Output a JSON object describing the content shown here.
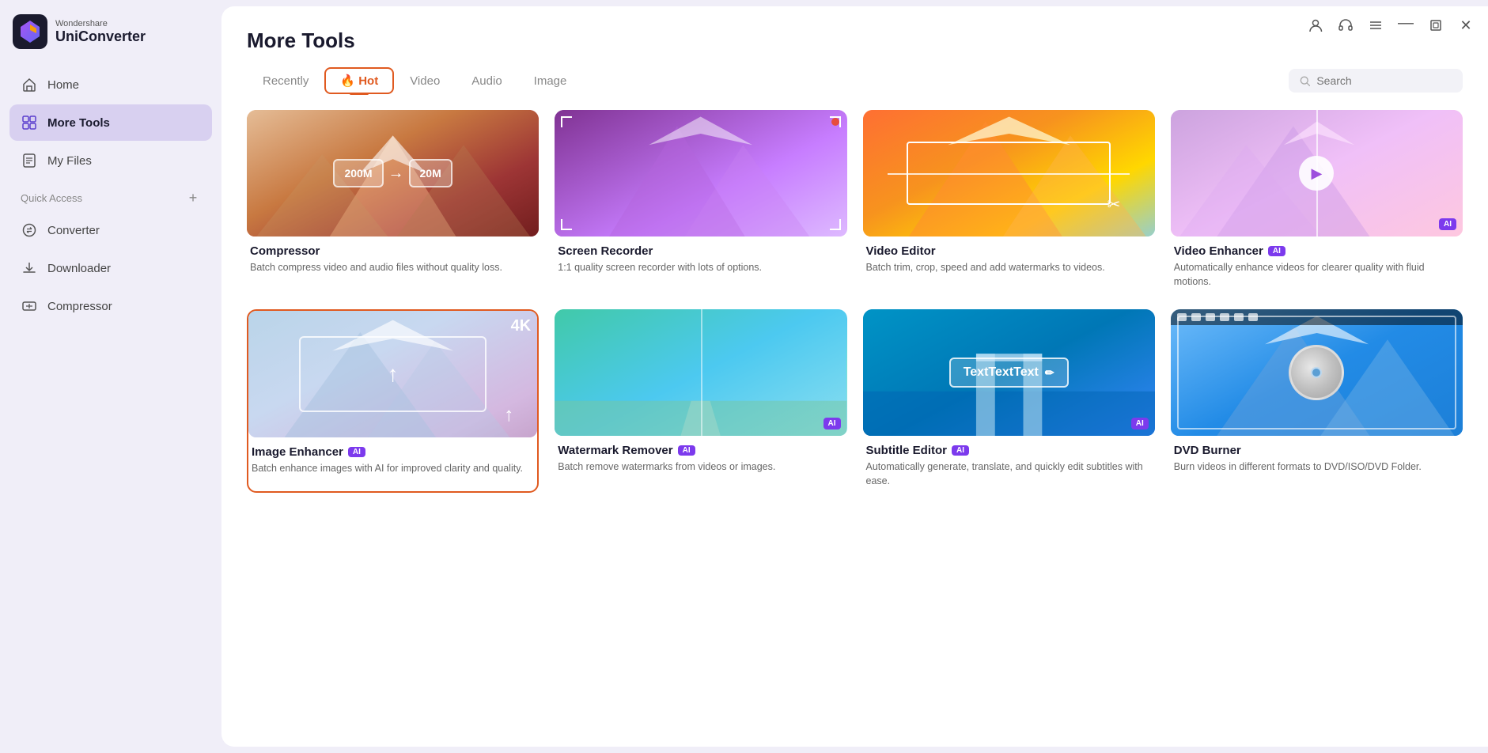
{
  "app": {
    "name": "UniConverter",
    "brand": "Wondershare"
  },
  "sidebar": {
    "nav": [
      {
        "id": "home",
        "label": "Home",
        "icon": "home"
      },
      {
        "id": "more-tools",
        "label": "More Tools",
        "icon": "grid",
        "active": true
      },
      {
        "id": "my-files",
        "label": "My Files",
        "icon": "file"
      }
    ],
    "quick_access_label": "Quick Access",
    "sub_nav": [
      {
        "id": "converter",
        "label": "Converter",
        "icon": "converter"
      },
      {
        "id": "downloader",
        "label": "Downloader",
        "icon": "downloader"
      },
      {
        "id": "compressor",
        "label": "Compressor",
        "icon": "compressor"
      }
    ]
  },
  "titlebar": {
    "buttons": [
      "profile",
      "headset",
      "menu",
      "minimize",
      "maximize",
      "close"
    ]
  },
  "page": {
    "title": "More Tools",
    "tabs": [
      {
        "id": "recently",
        "label": "Recently"
      },
      {
        "id": "hot",
        "label": "🔥 Hot",
        "active": true
      },
      {
        "id": "video",
        "label": "Video"
      },
      {
        "id": "audio",
        "label": "Audio"
      },
      {
        "id": "image",
        "label": "Image"
      }
    ],
    "search_placeholder": "Search"
  },
  "tools": [
    {
      "id": "compressor",
      "name": "Compressor",
      "desc": "Batch compress video and audio files without quality loss.",
      "ai": false,
      "thumb": "compressor",
      "from": "200M",
      "to": "20M",
      "selected": false
    },
    {
      "id": "screen-recorder",
      "name": "Screen Recorder",
      "desc": "1:1 quality screen recorder with lots of options.",
      "ai": false,
      "thumb": "screen-recorder",
      "selected": false
    },
    {
      "id": "video-editor",
      "name": "Video Editor",
      "desc": "Batch trim, crop, speed and add watermarks to videos.",
      "ai": false,
      "thumb": "video-editor",
      "selected": false
    },
    {
      "id": "video-enhancer",
      "name": "Video Enhancer",
      "desc": "Automatically enhance videos for clearer quality with fluid motions.",
      "ai": true,
      "thumb": "video-enhancer",
      "selected": false
    },
    {
      "id": "image-enhancer",
      "name": "Image Enhancer",
      "desc": "Batch enhance images with AI for improved clarity and quality.",
      "ai": true,
      "thumb": "image-enhancer",
      "selected": true
    },
    {
      "id": "watermark-remover",
      "name": "Watermark Remover",
      "desc": "Batch remove watermarks from videos or images.",
      "ai": true,
      "thumb": "watermark",
      "selected": false
    },
    {
      "id": "subtitle-editor",
      "name": "Subtitle Editor",
      "desc": "Automatically generate, translate, and quickly edit subtitles with ease.",
      "ai": true,
      "thumb": "subtitle",
      "selected": false
    },
    {
      "id": "dvd-burner",
      "name": "DVD Burner",
      "desc": "Burn videos in different formats to DVD/ISO/DVD Folder.",
      "ai": false,
      "thumb": "dvd",
      "selected": false
    }
  ]
}
